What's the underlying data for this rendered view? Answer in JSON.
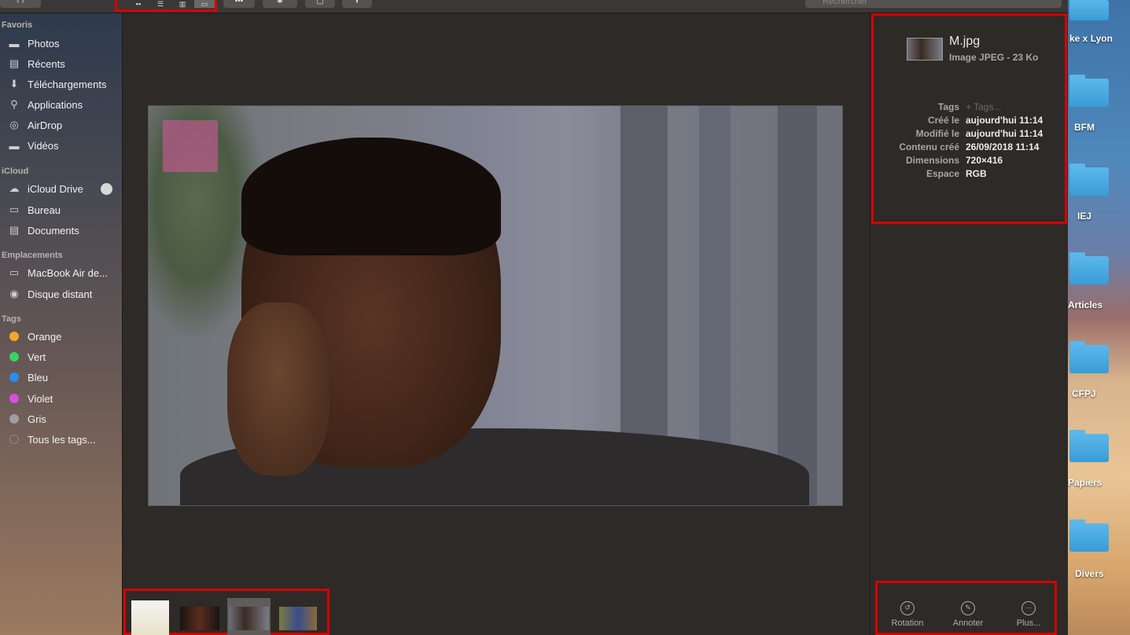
{
  "toolbar": {
    "view_buttons": [
      "icon-view",
      "list-view",
      "column-view",
      "gallery-view"
    ],
    "search_placeholder": "Rechercher"
  },
  "sidebar": {
    "sections": [
      {
        "title": "Favoris",
        "items": [
          {
            "label": "Photos",
            "icon": "folder-icon"
          },
          {
            "label": "Récents",
            "icon": "recents-icon"
          },
          {
            "label": "Téléchargements",
            "icon": "download-icon"
          },
          {
            "label": "Applications",
            "icon": "applications-icon"
          },
          {
            "label": "AirDrop",
            "icon": "airdrop-icon"
          },
          {
            "label": "Vidéos",
            "icon": "folder-icon"
          }
        ]
      },
      {
        "title": "iCloud",
        "items": [
          {
            "label": "iCloud Drive",
            "icon": "cloud-icon"
          },
          {
            "label": "Bureau",
            "icon": "desktop-icon"
          },
          {
            "label": "Documents",
            "icon": "document-icon"
          }
        ]
      },
      {
        "title": "Emplacements",
        "items": [
          {
            "label": "MacBook Air de...",
            "icon": "laptop-icon"
          },
          {
            "label": "Disque distant",
            "icon": "disc-icon"
          }
        ]
      },
      {
        "title": "Tags",
        "items": [
          {
            "label": "Orange",
            "color": "#f6a623"
          },
          {
            "label": "Vert",
            "color": "#3ed166"
          },
          {
            "label": "Bleu",
            "color": "#2c8cf4"
          },
          {
            "label": "Violet",
            "color": "#d84ee0"
          },
          {
            "label": "Gris",
            "color": "#9e9e9e"
          },
          {
            "label": "Tous les tags...",
            "color": "#6f6f6f"
          }
        ]
      }
    ]
  },
  "inspector": {
    "file_name": "M.jpg",
    "file_type": "Image JPEG - 23 Ko",
    "metadata": [
      {
        "key": "Tags",
        "value": "+ Tags..."
      },
      {
        "key": "Créé le",
        "value": "aujourd'hui 11:14"
      },
      {
        "key": "Modifié le",
        "value": "aujourd'hui 11:14"
      },
      {
        "key": "Contenu créé",
        "value": "26/09/2018 11:14"
      },
      {
        "key": "Dimensions",
        "value": "720×416"
      },
      {
        "key": "Espace",
        "value": "RGB"
      }
    ],
    "actions": [
      {
        "label": "Rotation",
        "icon": "rotate-icon"
      },
      {
        "label": "Annoter",
        "icon": "annotate-icon"
      },
      {
        "label": "Plus...",
        "icon": "more-icon"
      }
    ]
  },
  "desktop": {
    "items": [
      "ke x Lyon",
      "BFM",
      "IEJ",
      "Articles",
      "CFPJ",
      "Papiers",
      "Divers"
    ]
  },
  "colors": {
    "highlight": "#d50000",
    "folder": "#3a9cd6"
  }
}
